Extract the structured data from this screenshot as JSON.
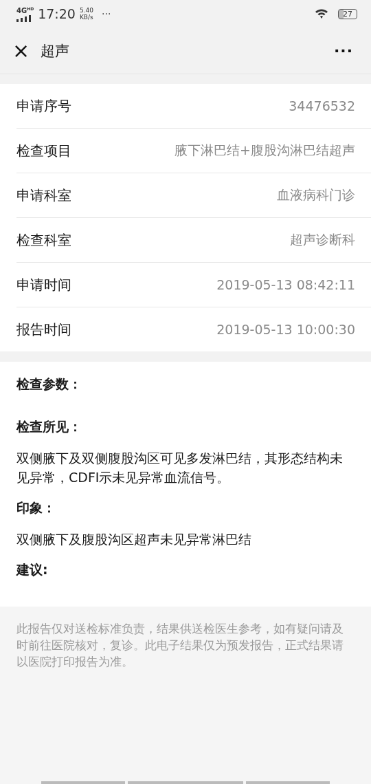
{
  "status_bar": {
    "network": "4G",
    "network_badge": "HD",
    "time": "17:20",
    "speed": "5.40",
    "speed_unit": "KB/s",
    "more": "···",
    "battery": "27"
  },
  "header": {
    "close": "×",
    "title": "超声",
    "menu": "···"
  },
  "fields": [
    {
      "label": "申请序号",
      "value": "34476532"
    },
    {
      "label": "检查项目",
      "value": "腋下淋巴结+腹股沟淋巴结超声"
    },
    {
      "label": "申请科室",
      "value": "血液病科门诊"
    },
    {
      "label": "检查科室",
      "value": "超声诊断科"
    },
    {
      "label": "申请时间",
      "value": "2019-05-13 08:42:11"
    },
    {
      "label": "报告时间",
      "value": "2019-05-13 10:00:30"
    }
  ],
  "sections": [
    {
      "heading": "检查参数："
    },
    {
      "heading": "检查所见：",
      "text": "双侧腋下及双侧腹股沟区可见多发淋巴结，其形态结构未见异常，CDFI示未见异常血流信号。"
    },
    {
      "heading": "印象：",
      "text": "双侧腋下及腹股沟区超声未见异常淋巴结"
    },
    {
      "heading": "建议:"
    }
  ],
  "disclaimer": "此报告仅对送检标准负责，结果供送检医生参考，如有疑问请及时前往医院核对，复诊。此电子结果仅为预发报告，正式结果请以医院打印报告为准。"
}
